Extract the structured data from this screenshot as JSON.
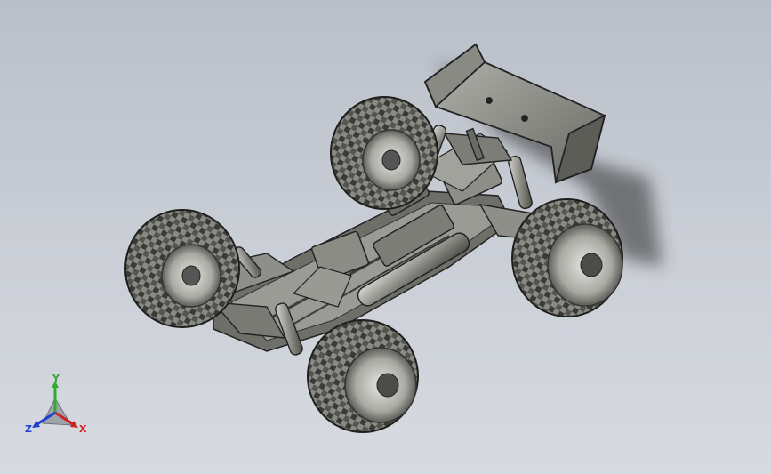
{
  "viewport": {
    "background_top": "#b9bfc9",
    "background_bottom": "#d7dae1",
    "model_color": "#7a7a72"
  },
  "triad": {
    "x_label": "X",
    "y_label": "Y",
    "z_label": "Z",
    "x_color": "#d02020",
    "y_color": "#33aa33",
    "z_color": "#2040d0"
  }
}
